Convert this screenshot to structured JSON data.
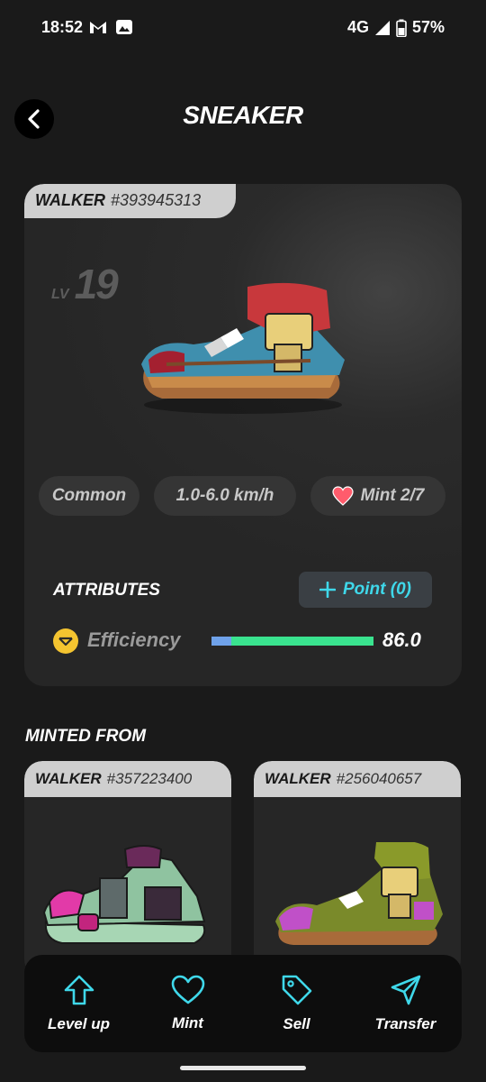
{
  "status_bar": {
    "time": "18:52",
    "network": "4G",
    "battery": "57%",
    "icons": [
      "gmail-icon",
      "photos-icon",
      "signal-icon",
      "battery-icon"
    ]
  },
  "header": {
    "title": "SNEAKER",
    "back_icon": "chevron-left-icon"
  },
  "sneaker": {
    "type": "WALKER",
    "id": "#393945313",
    "level_label": "LV",
    "level": "19",
    "rarity": "Common",
    "speed": "1.0-6.0 km/h",
    "mint": "Mint 2/7",
    "mint_icon": "heart-icon"
  },
  "attributes": {
    "title": "ATTRIBUTES",
    "point_button": "Point (0)",
    "efficiency": {
      "label": "Efficiency",
      "value": "86.0",
      "icon": "efficiency-coin-icon",
      "bar_base_fraction": 0.12,
      "bar_fill_fraction": 1.0,
      "colors": {
        "base": "#6fa2ea",
        "fill": "#3ae38f"
      }
    }
  },
  "minted_from": {
    "title": "MINTED FROM",
    "items": [
      {
        "type": "WALKER",
        "id": "#357223400"
      },
      {
        "type": "WALKER",
        "id": "#256040657"
      }
    ]
  },
  "actions": [
    {
      "label": "Level up",
      "icon": "arrow-up-icon"
    },
    {
      "label": "Mint",
      "icon": "heart-outline-icon"
    },
    {
      "label": "Sell",
      "icon": "tag-icon"
    },
    {
      "label": "Transfer",
      "icon": "send-icon"
    }
  ],
  "colors": {
    "accent": "#3fd8ea",
    "background": "#1a1a1a",
    "card": "#262626",
    "heart": "#ff5c6c"
  }
}
